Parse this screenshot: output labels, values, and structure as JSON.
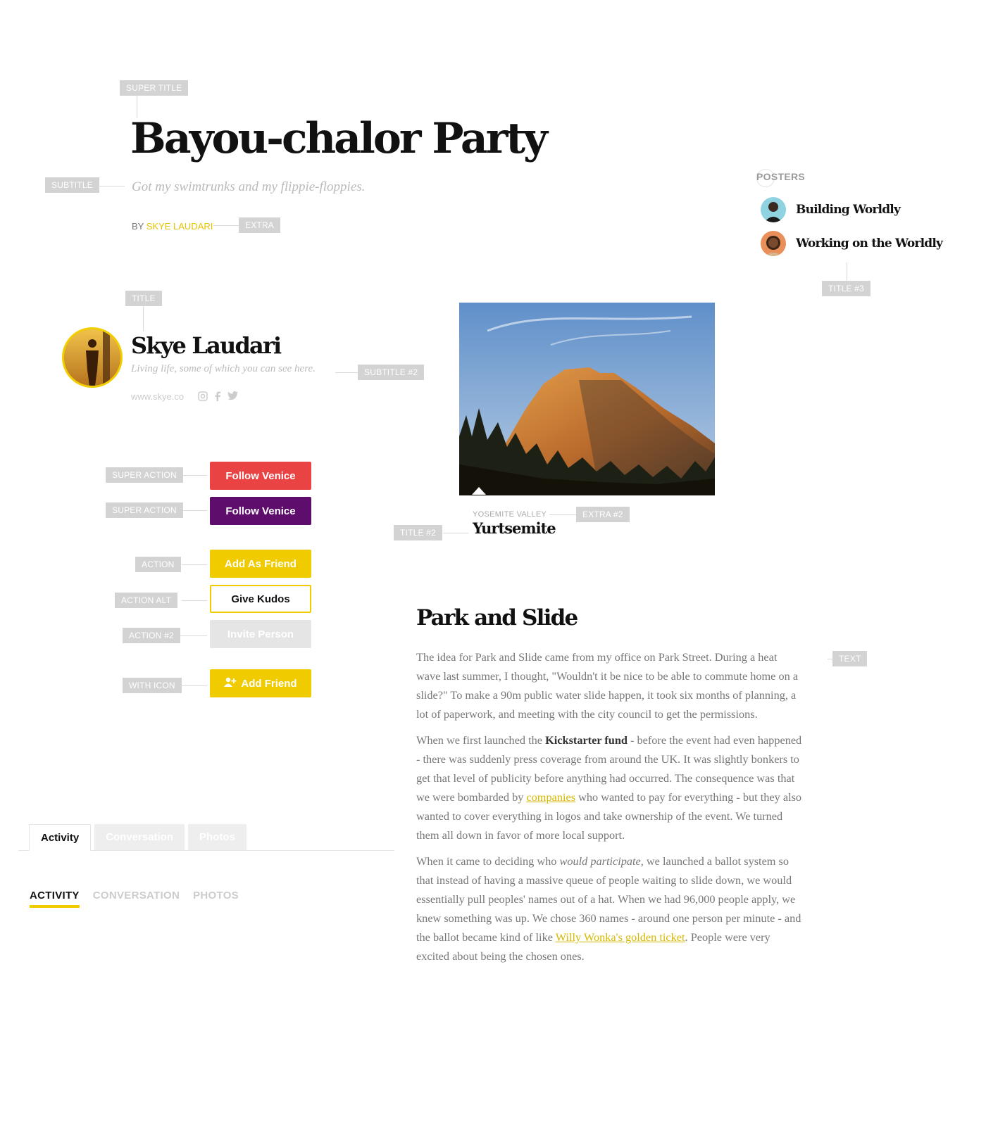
{
  "labels": {
    "super_title": "SUPER TITLE",
    "subtitle": "SUBTITLE",
    "extra": "EXTRA",
    "posters": "POSTERS",
    "title3": "TITLE #3",
    "title": "TITLE",
    "subtitle2": "SUBTITLE #2",
    "super_action_1": "SUPER ACTION",
    "super_action_2": "SUPER ACTION",
    "action": "ACTION",
    "action_alt": "ACTION ALT",
    "action2": "ACTION #2",
    "with_icon": "WITH ICON",
    "extra2": "EXTRA #2",
    "title2": "TITLE #2",
    "text": "TEXT"
  },
  "hero": {
    "title": "Bayou-chalor Party",
    "subtitle": "Got my swimtrunks and my flippie-floppies.",
    "by": "BY",
    "author": "SKYE LAUDARI"
  },
  "posters": {
    "items": [
      {
        "name": "Building Worldly"
      },
      {
        "name": "Working on the Worldly"
      }
    ]
  },
  "profile": {
    "name": "Skye Laudari",
    "tagline": "Living life, some of which you can see here.",
    "website": "www.skye.co",
    "social_icons": [
      "instagram-icon",
      "facebook-icon",
      "twitter-icon"
    ]
  },
  "buttons": {
    "follow_red": "Follow Venice",
    "follow_purple": "Follow Venice",
    "add_as_friend": "Add As Friend",
    "give_kudos": "Give Kudos",
    "invite_person": "Invite Person",
    "add_friend": "Add Friend"
  },
  "photo": {
    "extra": "YOSEMITE VALLEY",
    "title": "Yurtsemite"
  },
  "article": {
    "title": "Park and Slide",
    "p1": "The idea for Park and Slide came from my office on Park Street. During a heat wave last summer, I thought, \"Wouldn't it be nice to be able to commute home on a slide?\" To make a 90m public water slide happen, it took six months of planning, a lot of paperwork, and meeting with the city council to get the permissions.",
    "p2_a": "When we first launched the ",
    "p2_bold": "Kickstarter fund",
    "p2_b": " - before the event had even happened - there was suddenly press coverage from around the UK. It was slightly bonkers to get that level of publicity before anything had occurred. The consequence was that we were bombarded by ",
    "p2_link": "companies",
    "p2_c": " who wanted to pay for everything - but they also wanted to cover everything in logos and take ownership of the event. We turned them all down in favor of more local support.",
    "p3_a": "When it came to deciding who ",
    "p3_em": "would participate,",
    "p3_b": " we launched a ballot system so that instead of having a massive queue of people waiting to slide down, we would essentially pull peoples' names out of a hat. When we had 96,000 people apply, we knew something was up. We chose 360 names - around one person per minute - and the ballot became kind of like ",
    "p3_link": "Willy Wonka's golden ticket",
    "p3_c": ". People were very excited about being the chosen ones."
  },
  "tabs": [
    "Activity",
    "Conversation",
    "Photos"
  ],
  "tabs_upper": [
    "ACTIVITY",
    "CONVERSATION",
    "PHOTOS"
  ],
  "colors": {
    "accent_yellow": "#efcb00",
    "red": "#e94343",
    "purple": "#5e0d6c",
    "label_gray": "#d3d3d3"
  }
}
